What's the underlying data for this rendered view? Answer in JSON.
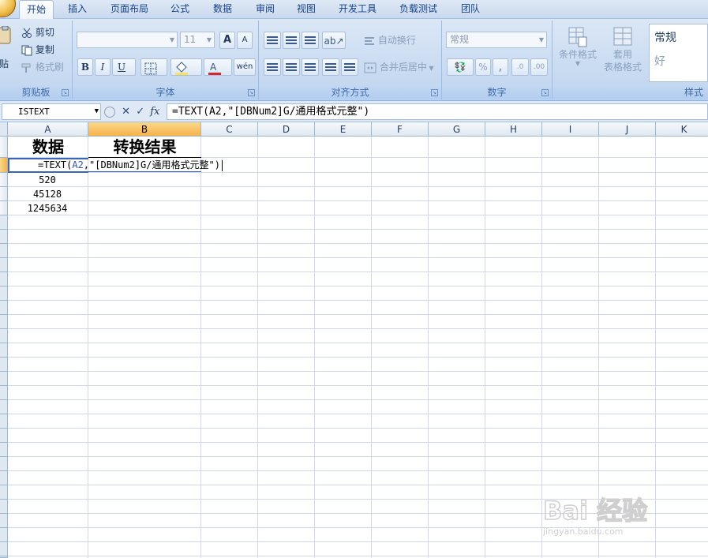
{
  "tabs": [
    "开始",
    "插入",
    "页面布局",
    "公式",
    "数据",
    "审阅",
    "视图",
    "开发工具",
    "负载测试",
    "团队"
  ],
  "ribbon": {
    "clipboard": {
      "paste": "贴",
      "cut": "剪切",
      "copy": "复制",
      "format_painter": "格式刷",
      "label": "剪贴板"
    },
    "font": {
      "font_name": "",
      "font_size": "11",
      "grow": "A",
      "shrink": "A",
      "bold": "B",
      "italic": "I",
      "underline": "U",
      "label": "字体",
      "phonetic": "wén"
    },
    "alignment": {
      "wrap_text": "自动换行",
      "merge_center": "合并后居中",
      "label": "对齐方式"
    },
    "number": {
      "format": "常规",
      "percent": "%",
      "comma": ",",
      "label": "数字"
    },
    "styles": {
      "conditional_format": "条件格式",
      "table_format_1": "套用",
      "table_format_2": "表格格式",
      "style_normal": "常规",
      "style_good": "好",
      "label": "样式"
    }
  },
  "formula_bar": {
    "name_box": "ISTEXT",
    "fx": "fx",
    "formula": "=TEXT(A2,\"[DBNum2]G/通用格式元整\")"
  },
  "columns": [
    "A",
    "B",
    "C",
    "D",
    "E",
    "F",
    "G",
    "H",
    "I",
    "J",
    "K"
  ],
  "cells": {
    "A1": "数据",
    "B1": "转换结果",
    "A2_edit_prefix": "=TEXT(",
    "A2_edit_ref": "A2",
    "A2_edit_rest": ",\"[DBNum2]G/通用格式元整\")",
    "A3": "520",
    "A4": "45128",
    "A5": "1245634"
  },
  "watermark": {
    "brand": "Bai 经验",
    "url": "jingyan.baidu.com"
  },
  "colors": {
    "active_header": "#f5b24a",
    "ribbon_bg": "#c7daf1",
    "grid_line": "#d0d7e5",
    "edit_border": "#3a66b8"
  }
}
